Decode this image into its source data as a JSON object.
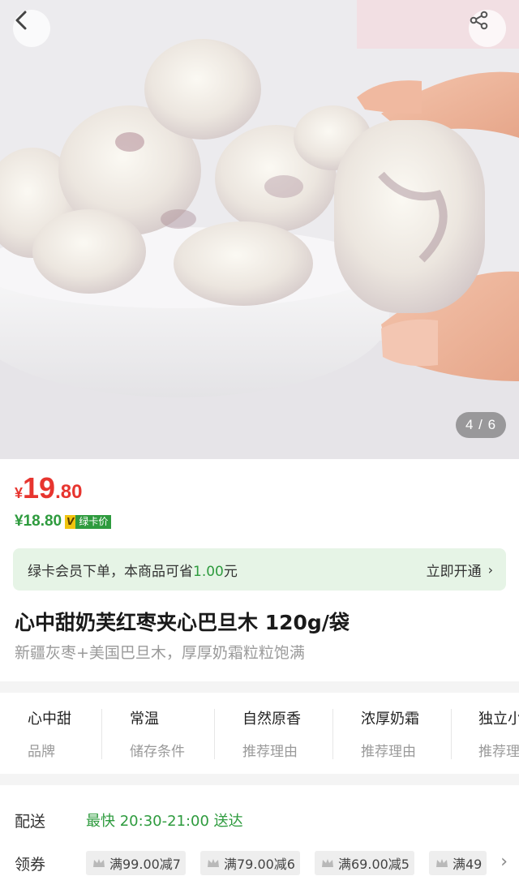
{
  "gallery": {
    "indicator": "4 / 6"
  },
  "price": {
    "currency": "¥",
    "integer": "19",
    "decimal": ".80",
    "member_price": "¥18.80",
    "badge_v": "V",
    "badge_text": "绿卡价"
  },
  "banner": {
    "text_prefix": "绿卡会员下单，本商品可省",
    "save_amount": "1.00",
    "text_suffix": "元",
    "action": "立即开通",
    "chevron": "›"
  },
  "product": {
    "title": "心中甜奶芙红枣夹心巴旦木 120g/袋",
    "subtitle": "新疆灰枣+美国巴旦木，厚厚奶霜粒粒饱满"
  },
  "attributes": [
    {
      "value": "心中甜",
      "key": "品牌"
    },
    {
      "value": "常温",
      "key": "储存条件"
    },
    {
      "value": "自然原香",
      "key": "推荐理由"
    },
    {
      "value": "浓厚奶霜",
      "key": "推荐理由"
    },
    {
      "value": "独立小",
      "key": "推荐理"
    }
  ],
  "delivery": {
    "label": "配送",
    "value": "最快 20:30-21:00 送达"
  },
  "coupons": {
    "label": "领券",
    "items": [
      "满99.00减7",
      "满79.00减6",
      "满69.00减5",
      "满49"
    ],
    "chevron": "›"
  },
  "colors": {
    "price_red": "#e7352f",
    "member_green": "#2e9b3e",
    "banner_bg": "#e6f4e6",
    "vip_gold": "#f1c40f"
  },
  "icons": [
    "back-arrow-icon",
    "share-icon",
    "coupon-crown-icon",
    "chevron-right-icon"
  ]
}
